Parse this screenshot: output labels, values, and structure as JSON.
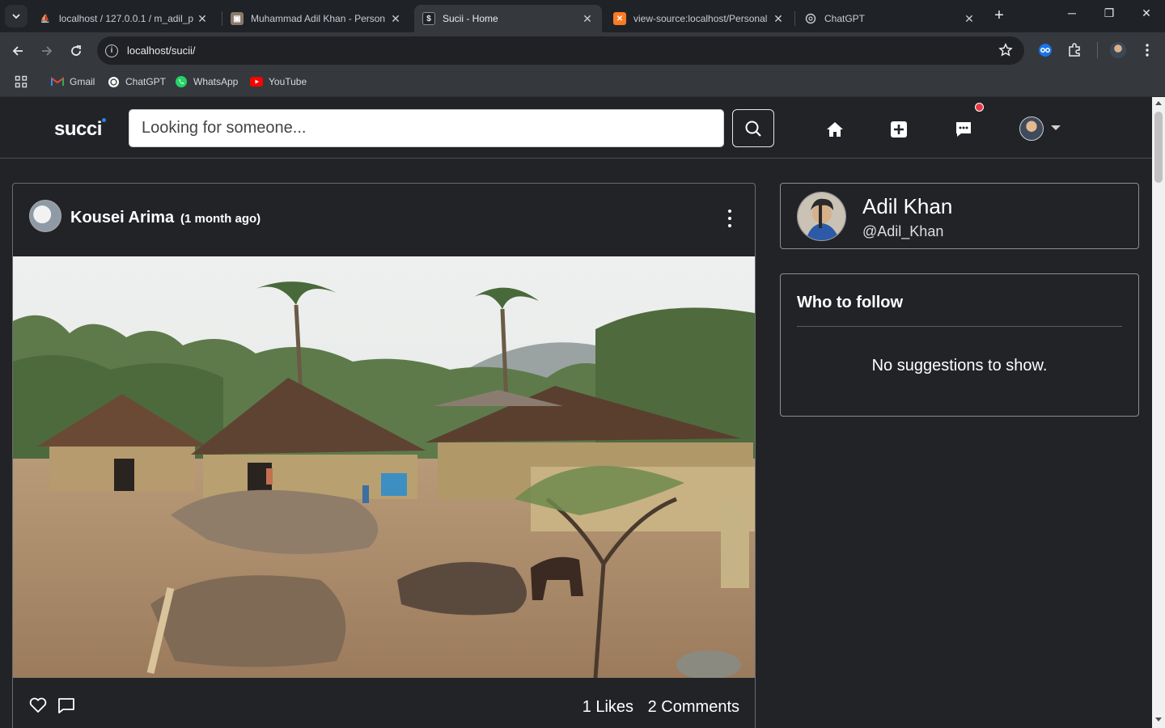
{
  "browser": {
    "tabs": [
      {
        "title": "localhost / 127.0.0.1 / m_adil_p",
        "favicon": "phpmyadmin-icon",
        "active": false
      },
      {
        "title": "Muhammad Adil Khan - Person",
        "favicon": "portrait-icon",
        "active": false
      },
      {
        "title": "Sucii - Home",
        "favicon": "dollar-icon",
        "active": true
      },
      {
        "title": "view-source:localhost/Personal",
        "favicon": "xampp-icon",
        "active": false
      },
      {
        "title": "ChatGPT",
        "favicon": "chatgpt-icon",
        "active": false
      }
    ],
    "url": "localhost/sucii/",
    "bookmarks": [
      {
        "label": "Gmail",
        "icon": "gmail-icon"
      },
      {
        "label": "ChatGPT",
        "icon": "chatgpt-icon"
      },
      {
        "label": "WhatsApp",
        "icon": "whatsapp-icon"
      },
      {
        "label": "YouTube",
        "icon": "youtube-icon"
      }
    ]
  },
  "app": {
    "logo": "succi",
    "search_placeholder": "Looking for someone...",
    "has_notification": true
  },
  "post": {
    "author": "Kousei Arima",
    "time": "(1 month ago)",
    "likes": "1 Likes",
    "comments": "2 Comments"
  },
  "profile": {
    "name": "Adil Khan",
    "handle": "@Adil_Khan"
  },
  "who_to_follow": {
    "title": "Who to follow",
    "empty_message": "No suggestions to show."
  },
  "colors": {
    "page_bg": "#212327",
    "chrome_bg": "#35393e",
    "tabstrip_bg": "#1f2328",
    "notification_dot": "#e63946",
    "logo_dot": "#2f80ed"
  }
}
